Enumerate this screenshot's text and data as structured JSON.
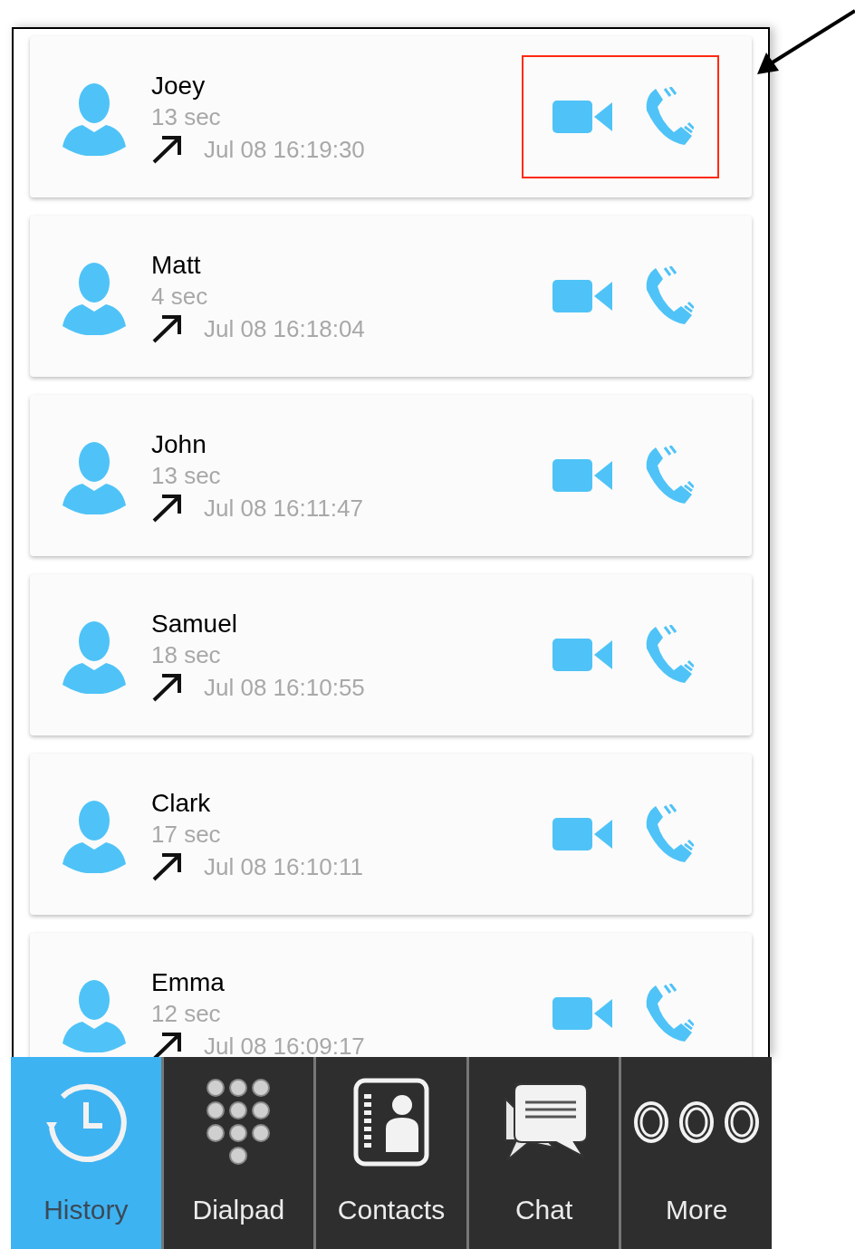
{
  "calls": [
    {
      "name": "Joey",
      "duration": "13 sec",
      "time": "Jul 08 16:19:30",
      "highlighted": true
    },
    {
      "name": "Matt",
      "duration": "4 sec",
      "time": "Jul 08 16:18:04",
      "highlighted": false
    },
    {
      "name": "John",
      "duration": "13 sec",
      "time": "Jul 08 16:11:47",
      "highlighted": false
    },
    {
      "name": "Samuel",
      "duration": "18 sec",
      "time": "Jul 08 16:10:55",
      "highlighted": false
    },
    {
      "name": "Clark",
      "duration": "17 sec",
      "time": "Jul 08 16:10:11",
      "highlighted": false
    },
    {
      "name": "Emma",
      "duration": "12 sec",
      "time": "Jul 08 16:09:17",
      "highlighted": false
    }
  ],
  "tabs": [
    {
      "kind": "history",
      "label": "History",
      "selected": true
    },
    {
      "kind": "dialpad",
      "label": "Dialpad",
      "selected": false
    },
    {
      "kind": "contacts",
      "label": "Contacts",
      "selected": false
    },
    {
      "kind": "chat",
      "label": "Chat",
      "selected": false
    },
    {
      "kind": "more",
      "label": "More",
      "selected": false
    }
  ]
}
